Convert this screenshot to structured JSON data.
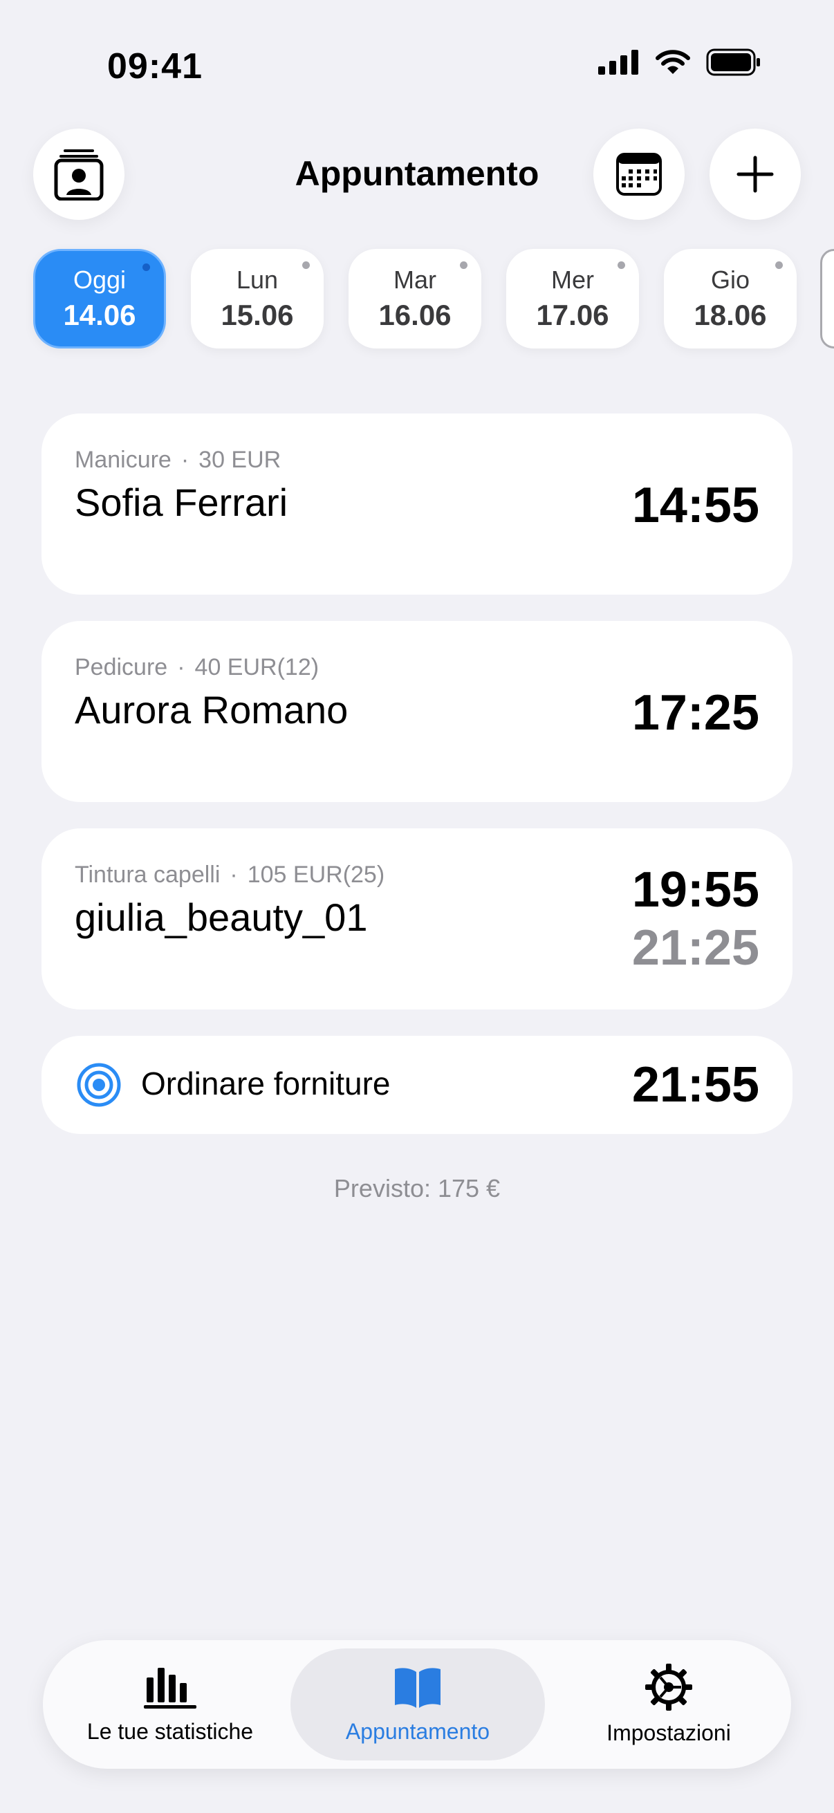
{
  "status_bar": {
    "time": "09:41"
  },
  "header": {
    "title": "Appuntamento"
  },
  "dates": [
    {
      "dow": "Oggi",
      "date": "14.06",
      "active": true
    },
    {
      "dow": "Lun",
      "date": "15.06"
    },
    {
      "dow": "Mar",
      "date": "16.06"
    },
    {
      "dow": "Mer",
      "date": "17.06"
    },
    {
      "dow": "Gio",
      "date": "18.06"
    }
  ],
  "appointments": [
    {
      "service": "Manicure",
      "price": "30 EUR",
      "client": "Sofia Ferrari",
      "time": "14:55"
    },
    {
      "service": "Pedicure",
      "price": "40 EUR(12)",
      "client": "Aurora Romano",
      "time": "17:25"
    },
    {
      "service": "Tintura capelli",
      "price": "105 EUR(25)",
      "client": "giulia_beauty_01",
      "time": "19:55",
      "end_time": "21:25"
    }
  ],
  "task": {
    "label": "Ordinare forniture",
    "time": "21:55"
  },
  "forecast": "Previsto: 175 €",
  "tabs": [
    {
      "label": "Le tue statistiche"
    },
    {
      "label": "Appuntamento"
    },
    {
      "label": "Impostazioni"
    }
  ],
  "colors": {
    "accent": "#2a8cf5",
    "background": "#f1f1f6",
    "muted": "#8e8e93"
  }
}
